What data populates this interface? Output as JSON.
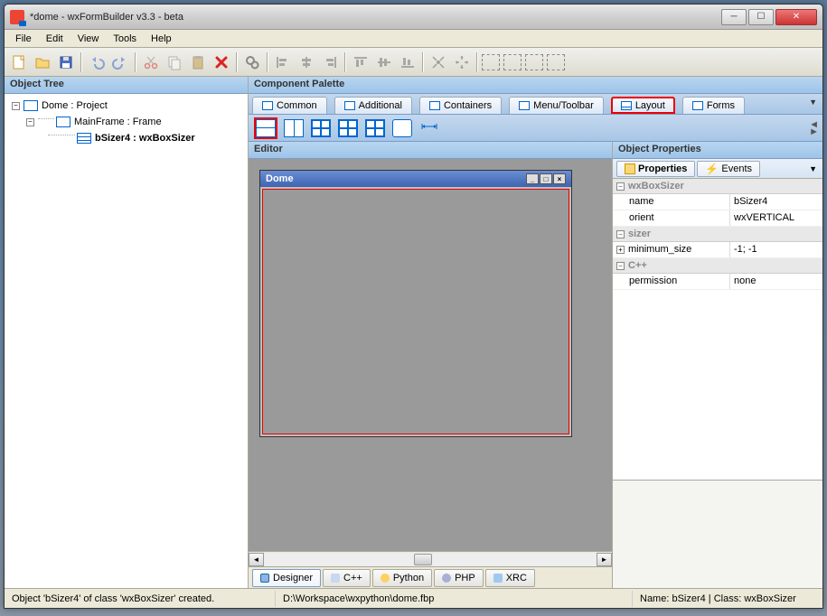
{
  "window": {
    "title": "*dome - wxFormBuilder v3.3 - beta"
  },
  "menu": {
    "file": "File",
    "edit": "Edit",
    "view": "View",
    "tools": "Tools",
    "help": "Help"
  },
  "left": {
    "header": "Object Tree",
    "project": "Dome : Project",
    "frame": "MainFrame : Frame",
    "sizer": "bSizer4 : wxBoxSizer"
  },
  "palette": {
    "header": "Component Palette",
    "tabs": {
      "common": "Common",
      "additional": "Additional",
      "containers": "Containers",
      "menu": "Menu/Toolbar",
      "layout": "Layout",
      "forms": "Forms"
    }
  },
  "editor": {
    "header": "Editor",
    "win_title": "Dome",
    "tabs": {
      "designer": "Designer",
      "cpp": "C++",
      "python": "Python",
      "php": "PHP",
      "xrc": "XRC"
    }
  },
  "props": {
    "header": "Object Properties",
    "tab_props": "Properties",
    "tab_events": "Events",
    "cat_wxboxsizer": "wxBoxSizer",
    "cat_sizer": "sizer",
    "cat_cpp": "C++",
    "rows": {
      "name_k": "name",
      "name_v": "bSizer4",
      "orient_k": "orient",
      "orient_v": "wxVERTICAL",
      "minsize_k": "minimum_size",
      "minsize_v": "-1; -1",
      "perm_k": "permission",
      "perm_v": "none"
    }
  },
  "status": {
    "msg": "Object 'bSizer4' of class 'wxBoxSizer' created.",
    "path": "D:\\Workspace\\wxpython\\dome.fbp",
    "info": "Name: bSizer4 | Class: wxBoxSizer"
  }
}
